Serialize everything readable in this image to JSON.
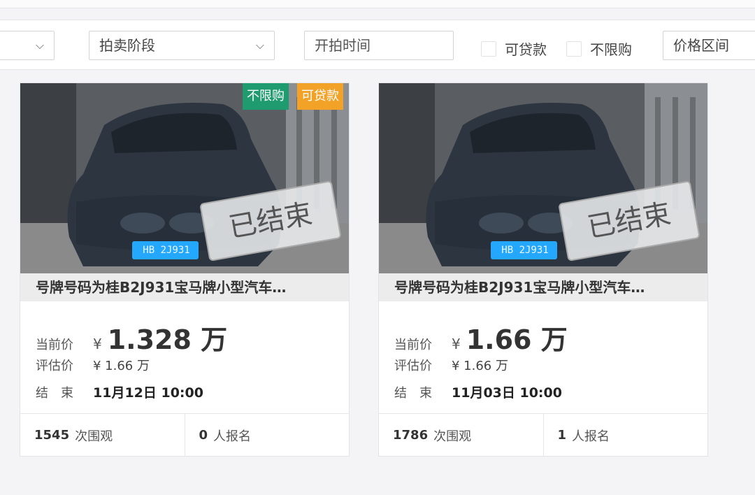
{
  "filters": {
    "stage_label": "拍卖阶段",
    "start_time_placeholder": "开拍时间",
    "loanable_label": "可贷款",
    "unlimited_label": "不限购",
    "price_range_label": "价格区间"
  },
  "cards": [
    {
      "tags": [
        "不限购",
        "可贷款"
      ],
      "plate": "HB 2J931",
      "stamp": "已结束",
      "title": "号牌号码为桂B2J931宝马牌小型汽车…",
      "current_price_label": "当前价",
      "currency": "¥",
      "current_price": "1.328 万",
      "appraisal_label": "评估价",
      "appraisal": "¥ 1.66 万",
      "end_label": "结　束",
      "end_time": "11月12日 10:00",
      "views_count": "1545",
      "views_label": "次围观",
      "signups_count": "0",
      "signups_label": "人报名"
    },
    {
      "tags": [],
      "plate": "HB 2J931",
      "stamp": "已结束",
      "title": "号牌号码为桂B2J931宝马牌小型汽车…",
      "current_price_label": "当前价",
      "currency": "¥",
      "current_price": "1.66 万",
      "appraisal_label": "评估价",
      "appraisal": "¥ 1.66 万",
      "end_label": "结　束",
      "end_time": "11月03日 10:00",
      "views_count": "1786",
      "views_label": "次围观",
      "signups_count": "1",
      "signups_label": "人报名"
    }
  ],
  "colors": {
    "tag_green": "#1e9b6f",
    "tag_orange": "#f1a227",
    "plate_blue": "#24a7ff"
  }
}
